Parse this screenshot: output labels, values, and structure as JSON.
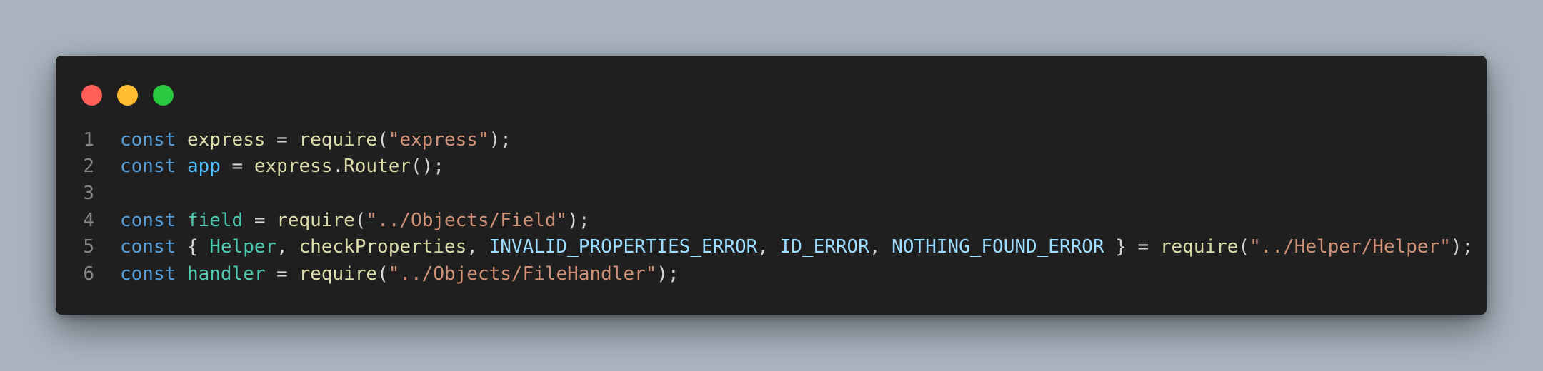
{
  "colors": {
    "background": "#a9b4bf",
    "window": "#1f1f1f",
    "close": "#ff5f57",
    "minimize": "#febc2e",
    "maximize": "#28c840",
    "line_number": "#858585",
    "keyword": "#569cd6",
    "function": "#dcdcaa",
    "string": "#ce9178",
    "variable": "#4fc1ff",
    "property": "#9cdcfe",
    "class": "#4ec9b0",
    "plain": "#d4d4d4"
  },
  "window_controls": [
    "close",
    "minimize",
    "maximize"
  ],
  "code_lines": [
    {
      "number": "1",
      "tokens": [
        {
          "text": "const",
          "role": "keyword"
        },
        {
          "text": " ",
          "role": "plain"
        },
        {
          "text": "express",
          "role": "function"
        },
        {
          "text": " = ",
          "role": "plain"
        },
        {
          "text": "require",
          "role": "function"
        },
        {
          "text": "(",
          "role": "plain"
        },
        {
          "text": "\"express\"",
          "role": "string"
        },
        {
          "text": ");",
          "role": "plain"
        }
      ]
    },
    {
      "number": "2",
      "tokens": [
        {
          "text": "const",
          "role": "keyword"
        },
        {
          "text": " ",
          "role": "plain"
        },
        {
          "text": "app",
          "role": "variable"
        },
        {
          "text": " = ",
          "role": "plain"
        },
        {
          "text": "express",
          "role": "function"
        },
        {
          "text": ".",
          "role": "plain"
        },
        {
          "text": "Router",
          "role": "function"
        },
        {
          "text": "();",
          "role": "plain"
        }
      ]
    },
    {
      "number": "3",
      "tokens": []
    },
    {
      "number": "4",
      "tokens": [
        {
          "text": "const",
          "role": "keyword"
        },
        {
          "text": " ",
          "role": "plain"
        },
        {
          "text": "field",
          "role": "class"
        },
        {
          "text": " = ",
          "role": "plain"
        },
        {
          "text": "require",
          "role": "function"
        },
        {
          "text": "(",
          "role": "plain"
        },
        {
          "text": "\"../Objects/Field\"",
          "role": "string"
        },
        {
          "text": ");",
          "role": "plain"
        }
      ]
    },
    {
      "number": "5",
      "tokens": [
        {
          "text": "const",
          "role": "keyword"
        },
        {
          "text": " { ",
          "role": "plain"
        },
        {
          "text": "Helper",
          "role": "class"
        },
        {
          "text": ", ",
          "role": "plain"
        },
        {
          "text": "checkProperties",
          "role": "function"
        },
        {
          "text": ", ",
          "role": "plain"
        },
        {
          "text": "INVALID_PROPERTIES_ERROR",
          "role": "property"
        },
        {
          "text": ", ",
          "role": "plain"
        },
        {
          "text": "ID_ERROR",
          "role": "property"
        },
        {
          "text": ", ",
          "role": "plain"
        },
        {
          "text": "NOTHING_FOUND_ERROR",
          "role": "property"
        },
        {
          "text": " } = ",
          "role": "plain"
        },
        {
          "text": "require",
          "role": "function"
        },
        {
          "text": "(",
          "role": "plain"
        },
        {
          "text": "\"../Helper/Helper\"",
          "role": "string"
        },
        {
          "text": ");",
          "role": "plain"
        }
      ]
    },
    {
      "number": "6",
      "tokens": [
        {
          "text": "const",
          "role": "keyword"
        },
        {
          "text": " ",
          "role": "plain"
        },
        {
          "text": "handler",
          "role": "class"
        },
        {
          "text": " = ",
          "role": "plain"
        },
        {
          "text": "require",
          "role": "function"
        },
        {
          "text": "(",
          "role": "plain"
        },
        {
          "text": "\"../Objects/FileHandler\"",
          "role": "string"
        },
        {
          "text": ");",
          "role": "plain"
        }
      ]
    }
  ]
}
